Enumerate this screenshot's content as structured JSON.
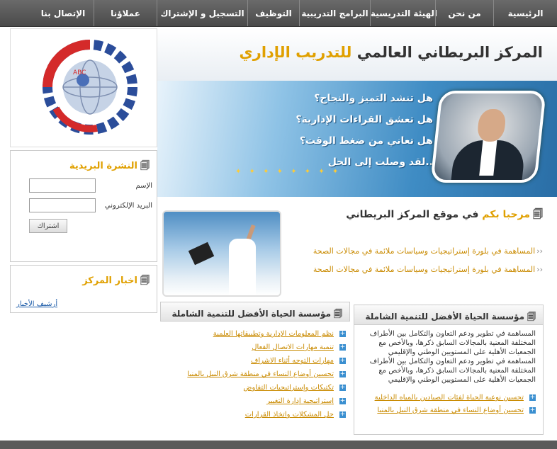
{
  "nav": {
    "items": [
      {
        "label": "الرئيسية",
        "w": 90
      },
      {
        "label": "من نحن",
        "w": 82
      },
      {
        "label": "الهيئة التدريسية",
        "w": 92
      },
      {
        "label": "البرامج التدريبية",
        "w": 100
      },
      {
        "label": "التوظيف",
        "w": 73
      },
      {
        "label": "التسجيل و الإشتراك",
        "w": 128
      },
      {
        "label": "عملاؤنا",
        "w": 89
      },
      {
        "label": "الإتصال بنا",
        "w": 86
      }
    ]
  },
  "header": {
    "title_main": "المركز البريطاني العالمي ",
    "title_highlight": "للتدريب الإداري"
  },
  "hero": {
    "lines": [
      "هل تنشد التميز والنجاح؟",
      "هل تعشق القراءات الإدارية؟",
      "هل تعاني من ضغط الوقت؟",
      "..لقد وصلت إلى الحل"
    ]
  },
  "newsletter": {
    "title": "النشرة البريدية",
    "name_label": "الإسم",
    "email_label": "البريد الإلكتروني",
    "subscribe_label": "اشتراك"
  },
  "news": {
    "title": "اخبار المركز",
    "archive_label": "أرشيف الأخبار"
  },
  "welcome": {
    "title_highlight": "مرحبا بكم",
    "title_rest": " في موقع المركز البريطاني",
    "lines": [
      "المساهمة في بلورة إستراتيجيات وسياسات ملائمة في مجالات الصحة",
      "المساهمة في بلورة إستراتيجيات وسياسات ملائمة في مجالات الصحة"
    ]
  },
  "box_left": {
    "title": "مؤسسة الحياة الأفضل للتنمية الشاملة",
    "items": [
      "نظم المعلومات الإدارية وتطبيقاتها العلمية",
      "تنمية مهارات الاتصال الفعال",
      "مهارات التوجه أثناء الاشراف",
      "تحسين أوضاع النساء في منطقة شرق النيل بالمنيا",
      "تكتيكات وإستراتيجيات التفاوض",
      "إستراتيجية إدارة التغيير",
      "حل المشكلات واتخاذ القرارات"
    ]
  },
  "box_right": {
    "title": "مؤسسة الحياة الأفضل للتنمية الشاملة",
    "description": "المساهمة في تطوير ودعم التعاون والتكامل بين الأطراف المختلفة المعنية بالمجالات السابق ذكرها، وبالأخص مع الجمعيات الأهلية على المستويين الوطني والإقليمي المساهمة في تطوير ودعم التعاون والتكامل بين الأطراف المختلفة المعنية بالمجالات السابق ذكرها، وبالأخص مع الجمعيات الأهلية على المستويين الوطني والإقليمي",
    "items": [
      "تحسين نوعية الحياة لفئات الصيادين بالمياه الداخلية",
      "تحسين أوضاع النساء في منطقة شرق النيل بالمنيا"
    ]
  },
  "colors": {
    "accent": "#e0a000",
    "nav_bg": "#555555",
    "hero_blue": "#3f8cc4"
  }
}
